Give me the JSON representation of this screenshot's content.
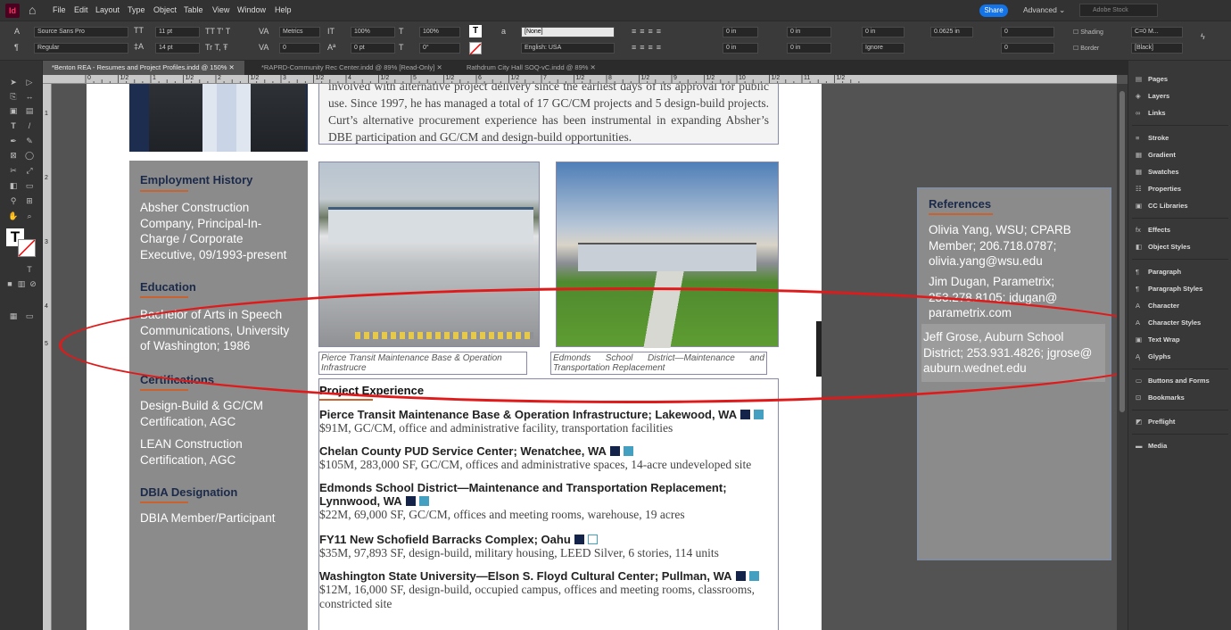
{
  "app": {
    "logo": "Id",
    "menus": [
      "File",
      "Edit",
      "Layout",
      "Type",
      "Object",
      "Table",
      "View",
      "Window",
      "Help"
    ],
    "share": "Share",
    "workspace": "Advanced",
    "stock_placeholder": "Adobe Stock"
  },
  "control": {
    "font": "Source Sans Pro",
    "style": "Regular",
    "size": "11 pt",
    "leading": "14 pt",
    "kerning": "Metrics",
    "tracking": "0",
    "hscale": "100%",
    "vscale": "100%",
    "baseline": "0 pt",
    "skew": "0°",
    "char_style": "[None]",
    "language": "English: USA",
    "indent_left": "0 in",
    "indent_right": "0 in",
    "space_before": "0 in",
    "space_after": "0 in",
    "first_indent": "0 in",
    "last_indent": "0 in",
    "hyphen": "Ignore",
    "drop_cap": "0",
    "drop_lines": "0",
    "stroke_weight": "0.0625 in",
    "shading": "Shading",
    "border": "Border",
    "swatch1": "C=0 M...",
    "swatch2": "[Black]"
  },
  "tabs": [
    "*Benton REA - Resumes and Project Profiles.indd @ 150%",
    "*RAPRD-Community Rec Center.indd @ 89% [Read-Only]",
    "Rathdrum City Hall SOQ-vC.indd @ 89%"
  ],
  "ruler": [
    "0",
    "1/2",
    "1",
    "1/2",
    "2",
    "1/2",
    "3",
    "1/2",
    "4",
    "1/2",
    "5",
    "1/2",
    "6",
    "1/2",
    "7",
    "1/2",
    "8",
    "1/2",
    "9",
    "1/2",
    "10",
    "1/2",
    "11",
    "1/2"
  ],
  "vruler": [
    "1",
    "2",
    "3",
    "4",
    "5"
  ],
  "doc": {
    "intro": "involved with alternative project delivery since the earliest days of its approval for public use. Since 1997, he has managed a total of 17 GC/CM projects and 5 design-build projects. Curt’s alternative procurement experience has been instrumental in expanding Absher’s DBE participation and GC/CM and design-build opportunities.",
    "sidebar": [
      {
        "head": "Employment History",
        "items": [
          "Absher Construction Company, Principal-In-Charge / Corporate Executive, 09/1993-present"
        ]
      },
      {
        "head": "Education",
        "items": [
          "Bachelor of Arts in Speech Communications, University of Washington; 1986"
        ]
      },
      {
        "head": "Certifications",
        "items": [
          "Design-Build & GC/CM Certification, AGC",
          "LEAN Construction Certification, AGC"
        ]
      },
      {
        "head": "DBIA Designation",
        "items": [
          "DBIA Member/Participant"
        ]
      }
    ],
    "captions": [
      "Pierce Transit Maintenance Base & Operation Infrastrucre",
      "Edmonds School District—Maintenance and Transportation Replacement"
    ],
    "project_head": "Project Experience",
    "projects": [
      {
        "title": "Pierce Transit Maintenance Base & Operation Infrastructure; Lakewood, WA",
        "desc": "$91M, GC/CM, office and administrative facility, transportation facilities",
        "marks": [
          "navy",
          "teal"
        ]
      },
      {
        "title": "Chelan County PUD Service Center; Wenatchee, WA",
        "desc": "$105M, 283,000 SF, GC/CM, offices and administrative spaces, 14-acre undeveloped site",
        "marks": [
          "navy",
          "teal"
        ]
      },
      {
        "title": "Edmonds School District—Maintenance and Transportation Replacement; Lynnwood, WA",
        "desc": "$22M, 69,000 SF, GC/CM, offices and meeting rooms, warehouse, 19 acres",
        "marks": [
          "navy",
          "teal"
        ]
      },
      {
        "title": "FY11 New Schofield Barracks Complex; Oahu",
        "desc": "$35M, 97,893 SF, design-build, military housing, LEED Silver, 6 stories, 114 units",
        "marks": [
          "navy",
          "empty"
        ]
      },
      {
        "title": "Washington State University—Elson S. Floyd Cultural Center; Pullman, WA",
        "desc": "$12M, 16,000 SF, design-build, occupied campus, offices and meeting rooms, classrooms, constricted site",
        "marks": [
          "navy",
          "teal"
        ]
      }
    ],
    "references": {
      "head": "References",
      "items": [
        "Olivia Yang, WSU; CPARB Member; 206.718.0787; olivia.yang@wsu.edu",
        "Jim Dugan, Parametrix; 253.278.8105; jdugan@ parametrix.com",
        "Jeff Grose, Auburn School District; 253.931.4826; jgrose@ auburn.wednet.edu"
      ]
    }
  },
  "panels": [
    [
      "Pages",
      "Layers",
      "Links"
    ],
    [
      "Stroke",
      "Gradient",
      "Swatches",
      "Properties",
      "CC Libraries"
    ],
    [
      "Effects",
      "Object Styles"
    ],
    [
      "Paragraph",
      "Paragraph Styles",
      "Character",
      "Character Styles",
      "Text Wrap",
      "Glyphs"
    ],
    [
      "Buttons and Forms",
      "Bookmarks"
    ],
    [
      "Preflight"
    ],
    [
      "Media"
    ]
  ],
  "colors": {
    "annotation": "#e01a1a",
    "navy": "#13234a",
    "teal": "#44a0c0",
    "accent": "#c9622f"
  }
}
